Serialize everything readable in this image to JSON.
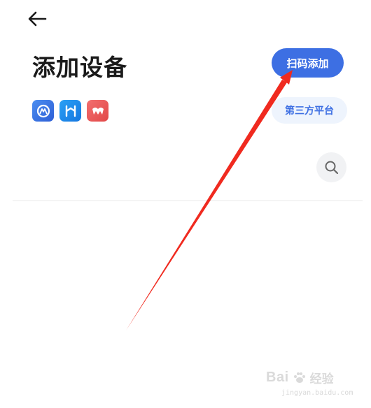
{
  "header": {
    "back_icon": "arrow-left-icon",
    "title": "添加设备",
    "scan_button_label": "扫码添加"
  },
  "platforms": {
    "icons": [
      "platform-app-icon-blue",
      "platform-app-icon-h",
      "platform-app-icon-red"
    ],
    "third_party_label": "第三方平台"
  },
  "search": {
    "icon": "search-icon"
  },
  "colors": {
    "accent": "#3d6fe3",
    "third_party_bg": "#eef4fd",
    "annotation_arrow": "#f02a1f"
  },
  "watermark": {
    "brand": "Bai",
    "sub": "经验",
    "url": "jingyan.baidu.com"
  }
}
